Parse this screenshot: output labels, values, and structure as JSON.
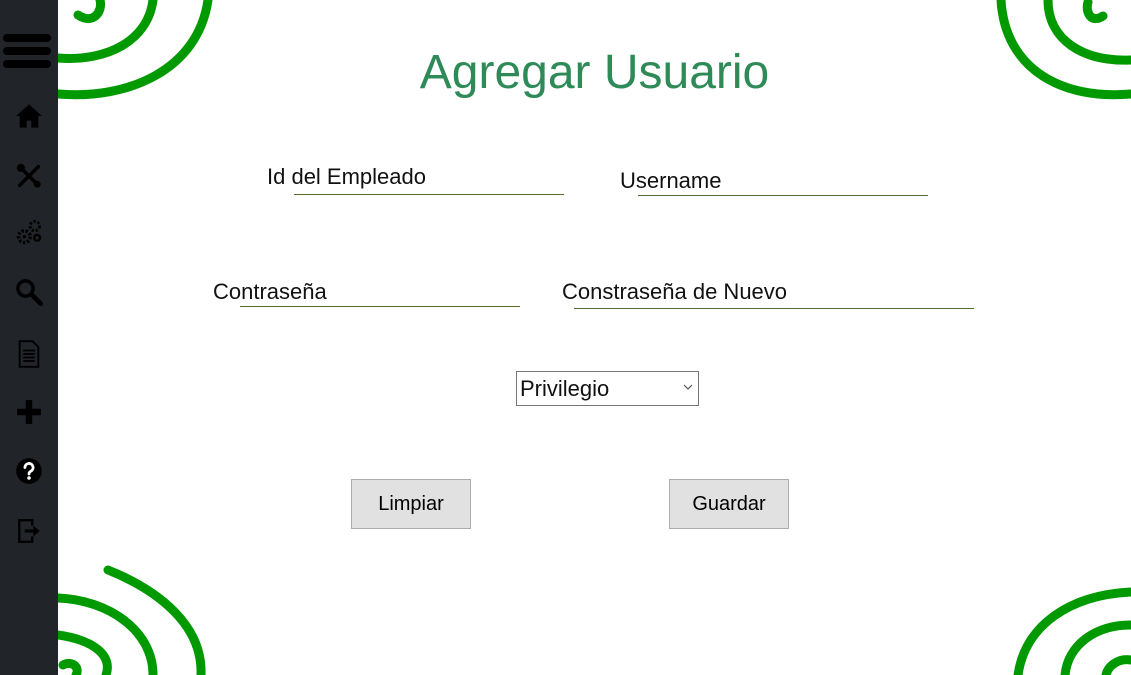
{
  "title": "Agregar Usuario",
  "sidebar": {
    "items": [
      {
        "icon": "home-icon"
      },
      {
        "icon": "tools-icon"
      },
      {
        "icon": "gears-icon"
      },
      {
        "icon": "search-icon"
      },
      {
        "icon": "document-icon"
      },
      {
        "icon": "plus-icon"
      },
      {
        "icon": "help-icon"
      },
      {
        "icon": "logout-icon"
      }
    ]
  },
  "form": {
    "employee_id_label": "Id del Empleado",
    "username_label": "Username",
    "password_label": "Contraseña",
    "password_repeat_label": "Constraseña de Nuevo",
    "privilege_select": "Privilegio",
    "clear_button": "Limpiar",
    "save_button": "Guardar"
  },
  "colors": {
    "accent": "#2e8b57",
    "decoration": "#009a00",
    "sidebar_bg": "#212529"
  }
}
